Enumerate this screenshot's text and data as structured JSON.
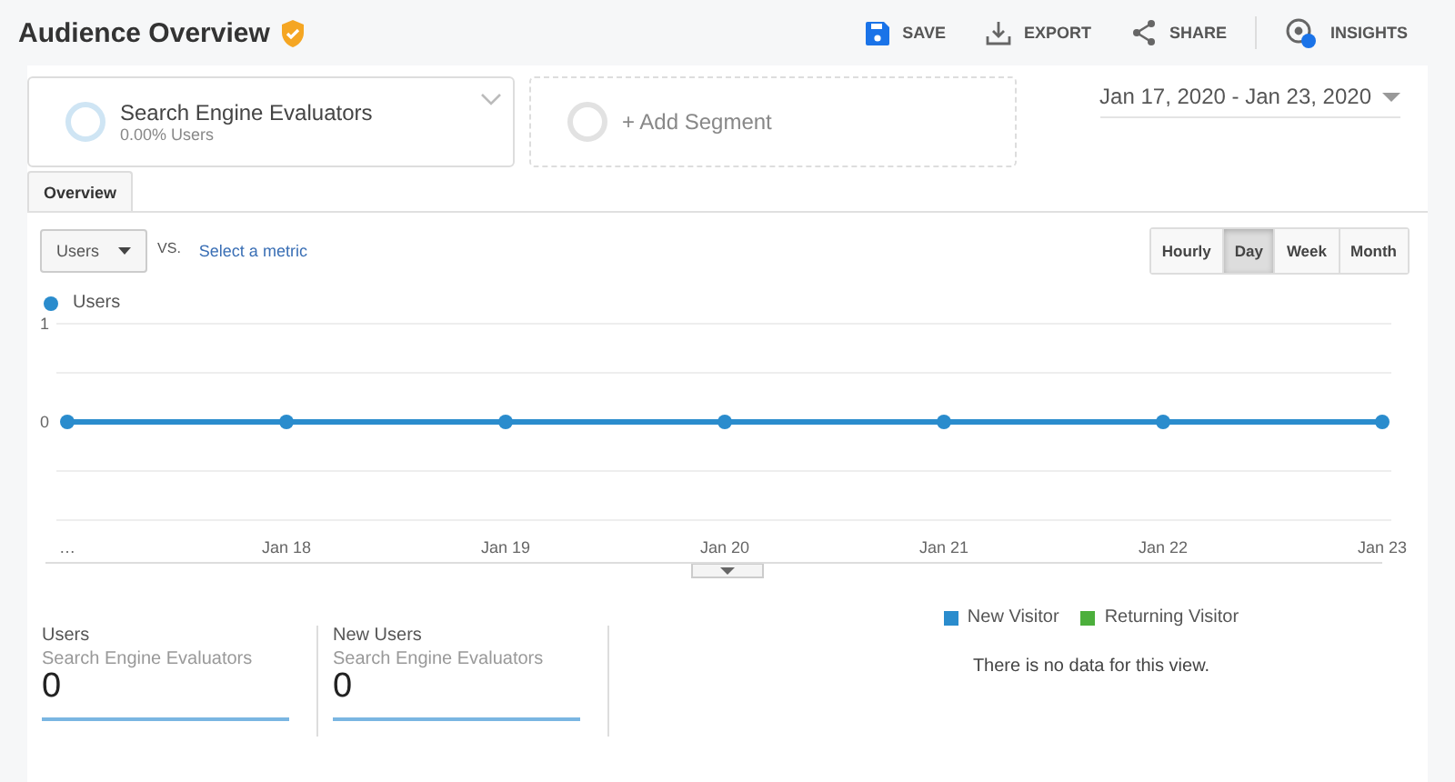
{
  "header": {
    "title": "Audience Overview",
    "actions": [
      {
        "kind": "save",
        "label": "SAVE"
      },
      {
        "kind": "export",
        "label": "EXPORT"
      },
      {
        "kind": "share",
        "label": "SHARE"
      },
      {
        "kind": "insights",
        "label": "INSIGHTS"
      }
    ]
  },
  "segments": [
    {
      "kind": "segment",
      "name": "Search Engine Evaluators",
      "detail": "0.00% Users"
    },
    {
      "kind": "add",
      "name": "+ Add Segment"
    }
  ],
  "date_range": "Jan 17, 2020 - Jan 23, 2020",
  "tabs": [
    {
      "label": "Overview",
      "selected": true
    }
  ],
  "metric": {
    "value": "Users",
    "vs": "VS.",
    "link": "Select a metric"
  },
  "granularity": [
    {
      "label": "Hourly",
      "selected": false
    },
    {
      "label": "Day",
      "selected": true
    },
    {
      "label": "Week",
      "selected": false
    },
    {
      "label": "Month",
      "selected": false
    }
  ],
  "chart": {
    "chart_data": {
      "type": "line",
      "categories": [
        "…",
        "Jan 18",
        "Jan 19",
        "Jan 20",
        "Jan 21",
        "Jan 22",
        "Jan 23"
      ],
      "series": [
        {
          "name": "Users",
          "color": "#2a8ccd",
          "marker": "circle",
          "values": [
            0,
            0,
            0,
            0,
            0,
            0,
            0
          ]
        }
      ],
      "ylim": [
        -1,
        1
      ],
      "yticks": [
        0,
        1
      ],
      "ref_lines": [
        {
          "axis": "y",
          "value": 0.5
        },
        {
          "axis": "y",
          "value": -0.5
        }
      ]
    }
  },
  "scorecards": [
    {
      "label": "Users",
      "segment": "Search Engine Evaluators",
      "value": "0"
    },
    {
      "label": "New Users",
      "segment": "Search Engine Evaluators",
      "value": "0"
    }
  ],
  "pie": {
    "legend": [
      {
        "label": "New Visitor",
        "color": "#2a8ccd"
      },
      {
        "label": "Returning Visitor",
        "color": "#4caf3c"
      }
    ],
    "message": "There is no data for this view."
  }
}
